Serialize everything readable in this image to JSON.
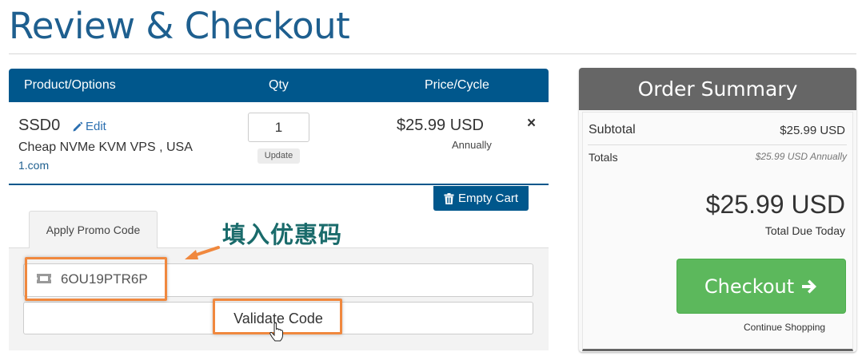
{
  "page": {
    "title": "Review & Checkout"
  },
  "cart": {
    "headers": {
      "product": "Product/Options",
      "qty": "Qty",
      "price": "Price/Cycle"
    },
    "item": {
      "name": "SSD0",
      "edit_label": "Edit",
      "description": "Cheap NVMe KVM VPS , USA",
      "domain": "1.com",
      "quantity": "1",
      "update_label": "Update",
      "price": "$25.99 USD",
      "cycle": "Annually",
      "remove_label": "×"
    },
    "empty_cart_label": "Empty Cart"
  },
  "promo": {
    "tab_label": "Apply Promo Code",
    "code_value": "6OU19PTR6P",
    "validate_label": "Validate Code"
  },
  "annotation": {
    "label": "填入优惠码",
    "color": "#f0883e"
  },
  "summary": {
    "title": "Order Summary",
    "subtotal_label": "Subtotal",
    "subtotal_value": "$25.99 USD",
    "totals_label": "Totals",
    "totals_value": "$25.99 USD Annually",
    "total_amount": "$25.99 USD",
    "total_due_label": "Total Due Today",
    "checkout_label": "Checkout",
    "continue_label": "Continue Shopping"
  },
  "colors": {
    "brand_blue": "#00578c",
    "title_blue": "#1e5f8f",
    "checkout_green": "#5cb85c",
    "summary_header": "#666666"
  }
}
